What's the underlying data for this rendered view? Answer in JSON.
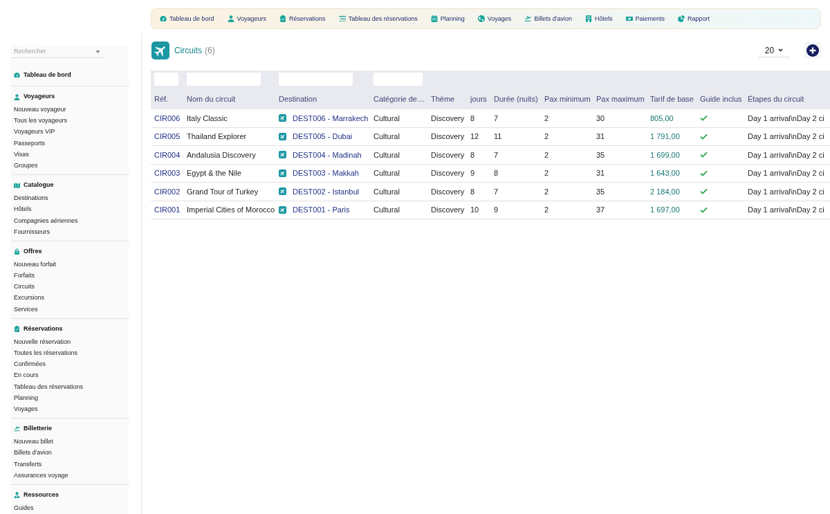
{
  "nav": [
    "Tableau de bord",
    "Voyageurs",
    "Réservations",
    "Tableau des réservations",
    "Planning",
    "Voyages",
    "Billets d'avion",
    "Hôtels",
    "Paiements",
    "Rapport"
  ],
  "sidebar": {
    "search": {
      "placeholder": "Rechercher"
    },
    "sections": [
      {
        "title": "Tableau de bord"
      },
      {
        "title": "Voyageurs",
        "items": [
          "Nouveau voyageur",
          "Tous les voyageurs",
          "Voyageurs VIP",
          "Passeports",
          "Visas",
          "Groupes"
        ]
      },
      {
        "title": "Catalogue",
        "items": [
          "Destinations",
          "Hôtels",
          "Compagnies aériennes",
          "Fournisseurs"
        ]
      },
      {
        "title": "Offres",
        "items": [
          "Nouveau forfait",
          "Forfaits",
          "Circuits",
          "Excursions",
          "Services"
        ]
      },
      {
        "title": "Réservations",
        "items": [
          "Nouvelle réservation",
          "Toutes les réservations",
          "Confirmées",
          "En cours",
          "Tableau des réservations",
          "Planning",
          "Voyages"
        ]
      },
      {
        "title": "Billetterie",
        "items": [
          "Nouveau billet",
          "Billets d'avion",
          "Transferts",
          "Assurances voyage"
        ]
      },
      {
        "title": "Ressources",
        "items": [
          "Guides"
        ]
      }
    ]
  },
  "page": {
    "title": "Circuits",
    "count": "(6)",
    "page_size": "20"
  },
  "table": {
    "columns": [
      {
        "label": "Réf.",
        "filter": true
      },
      {
        "label": "Nom du circuit",
        "filter": true
      },
      {
        "label": "Destination",
        "filter": true
      },
      {
        "label": "Catégorie de…",
        "filter": true
      },
      {
        "label": "Thème",
        "filter": false
      },
      {
        "label": "jours",
        "filter": false
      },
      {
        "label": "Durée (nuits)",
        "filter": false
      },
      {
        "label": "Pax minimum",
        "filter": false
      },
      {
        "label": "Pax maximum",
        "filter": false
      },
      {
        "label": "Tarif de base",
        "filter": false
      },
      {
        "label": "Guide inclus",
        "filter": false
      },
      {
        "label": "Étapes du circuit",
        "filter": false
      }
    ],
    "rows": [
      {
        "ref": "CIR006",
        "name": "Italy Classic",
        "destination": "DEST006 - Marrakech",
        "category": "Cultural",
        "theme": "Discovery",
        "days": "8",
        "nights": "7",
        "pax_min": "2",
        "pax_max": "30",
        "price": "805,00",
        "guide_included": true,
        "stages": "Day 1 arrival\\nDay 2 ci"
      },
      {
        "ref": "CIR005",
        "name": "Thailand Explorer",
        "destination": "DEST005 - Dubai",
        "category": "Cultural",
        "theme": "Discovery",
        "days": "12",
        "nights": "11",
        "pax_min": "2",
        "pax_max": "31",
        "price": "1 791,00",
        "guide_included": true,
        "stages": "Day 1 arrival\\nDay 2 ci"
      },
      {
        "ref": "CIR004",
        "name": "Andalusia Discovery",
        "destination": "DEST004 - Madinah",
        "category": "Cultural",
        "theme": "Discovery",
        "days": "8",
        "nights": "7",
        "pax_min": "2",
        "pax_max": "35",
        "price": "1 699,00",
        "guide_included": true,
        "stages": "Day 1 arrival\\nDay 2 ci"
      },
      {
        "ref": "CIR003",
        "name": "Egypt & the Nile",
        "destination": "DEST003 - Makkah",
        "category": "Cultural",
        "theme": "Discovery",
        "days": "9",
        "nights": "8",
        "pax_min": "2",
        "pax_max": "31",
        "price": "1 643,00",
        "guide_included": true,
        "stages": "Day 1 arrival\\nDay 2 ci"
      },
      {
        "ref": "CIR002",
        "name": "Grand Tour of Turkey",
        "destination": "DEST002 - Istanbul",
        "category": "Cultural",
        "theme": "Discovery",
        "days": "8",
        "nights": "7",
        "pax_min": "2",
        "pax_max": "35",
        "price": "2 184,00",
        "guide_included": true,
        "stages": "Day 1 arrival\\nDay 2 ci"
      },
      {
        "ref": "CIR001",
        "name": "Imperial Cities of Morocco",
        "destination": "DEST001 - Paris",
        "category": "Cultural",
        "theme": "Discovery",
        "days": "10",
        "nights": "9",
        "pax_min": "2",
        "pax_max": "37",
        "price": "1 697,00",
        "guide_included": true,
        "stages": "Day 1 arrival\\nDay 2 ci"
      }
    ]
  }
}
